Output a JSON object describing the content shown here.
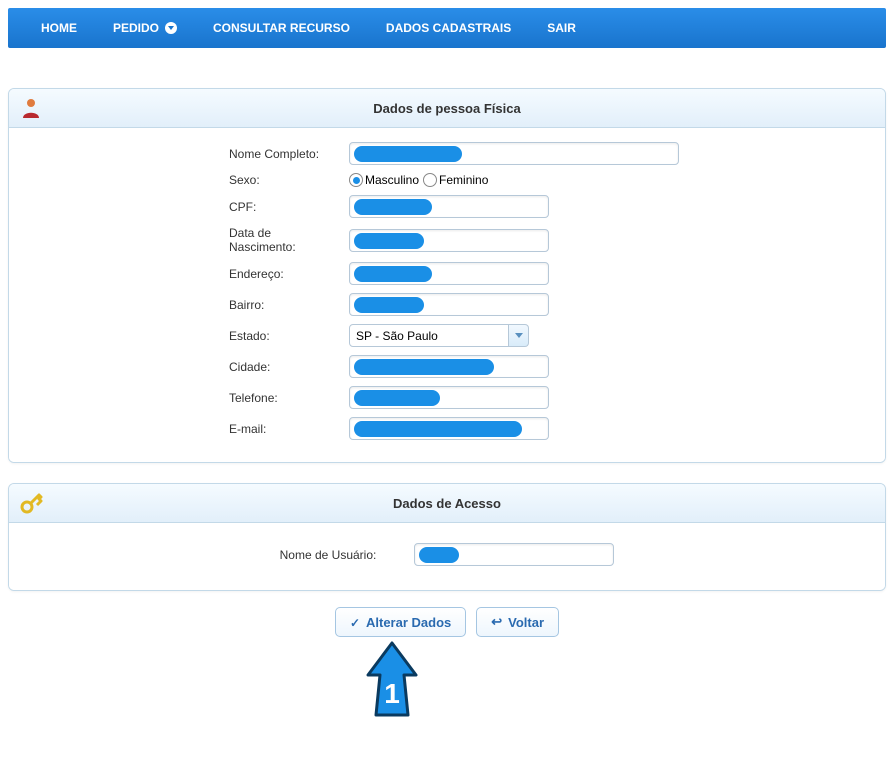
{
  "nav": {
    "items": [
      {
        "label": "HOME"
      },
      {
        "label": "PEDIDO",
        "has_dropdown": true
      },
      {
        "label": "CONSULTAR RECURSO"
      },
      {
        "label": "DADOS CADASTRAIS"
      },
      {
        "label": "SAIR"
      }
    ]
  },
  "panel_person": {
    "title": "Dados de pessoa Física",
    "fields": {
      "nome_completo_label": "Nome Completo:",
      "sexo_label": "Sexo:",
      "sexo_options": {
        "masculino": "Masculino",
        "feminino": "Feminino"
      },
      "sexo_selected": "masculino",
      "cpf_label": "CPF:",
      "nascimento_label": "Data de Nascimento:",
      "endereco_label": "Endereço:",
      "bairro_label": "Bairro:",
      "estado_label": "Estado:",
      "estado_value": "SP - São Paulo",
      "cidade_label": "Cidade:",
      "telefone_label": "Telefone:",
      "email_label": "E-mail:"
    }
  },
  "panel_access": {
    "title": "Dados de Acesso",
    "username_label": "Nome de Usuário:"
  },
  "buttons": {
    "alterar": "Alterar Dados",
    "voltar": "Voltar"
  },
  "callout": {
    "number": "1"
  }
}
